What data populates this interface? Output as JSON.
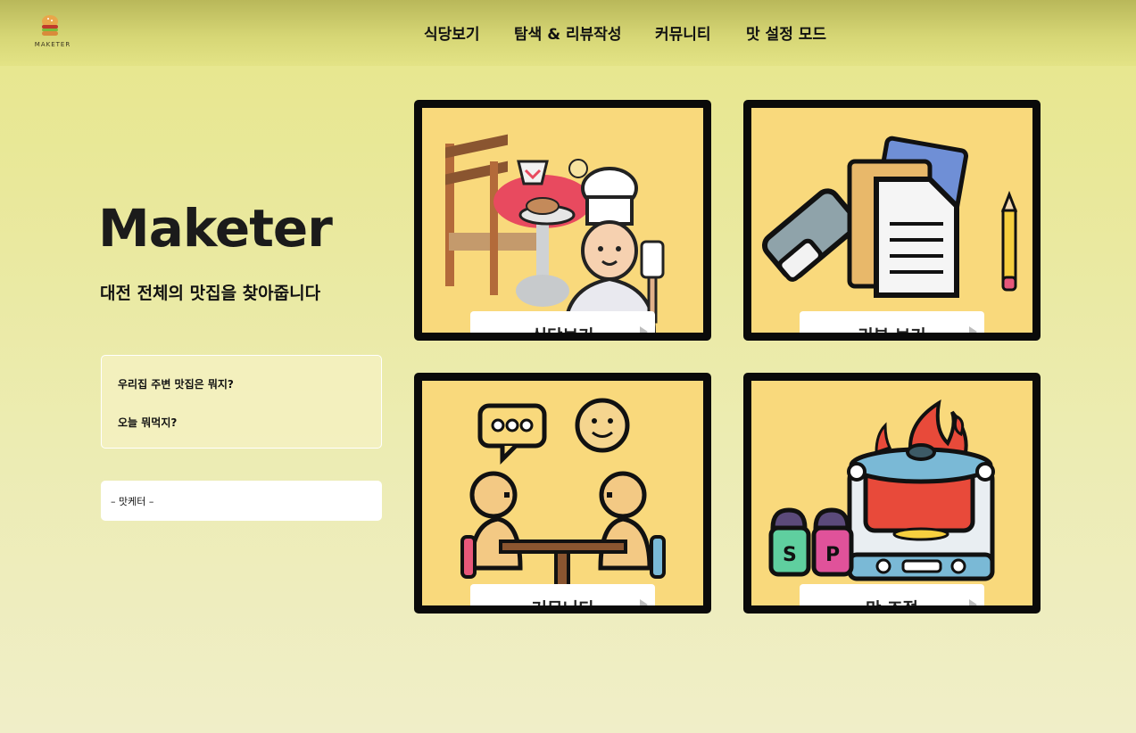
{
  "header": {
    "logo_text": "MAKETER",
    "nav": [
      "식당보기",
      "탐색 & 리뷰작성",
      "커뮤니티",
      "맛 설정 모드"
    ]
  },
  "hero": {
    "title": "Maketer",
    "subtitle": "대전 전체의 맛집을 찾아줍니다",
    "quotes": [
      "우리집 주변 맛집은 뭐지?",
      "오늘 뭐먹지?"
    ],
    "signature": "– 맛케터 –"
  },
  "cards": [
    {
      "label": "식당보기",
      "icon": "restaurant-chef-icon"
    },
    {
      "label": "리뷰 보기",
      "icon": "review-documents-icon"
    },
    {
      "label": "커뮤니티",
      "icon": "community-chat-icon"
    },
    {
      "label": "맛 조절",
      "icon": "cooking-pot-icon"
    }
  ],
  "colors": {
    "card_bg": "#f9d97c",
    "card_border": "#0a0a0a",
    "header_bg": "#c9c86a",
    "page_bg": "#e8e796"
  }
}
